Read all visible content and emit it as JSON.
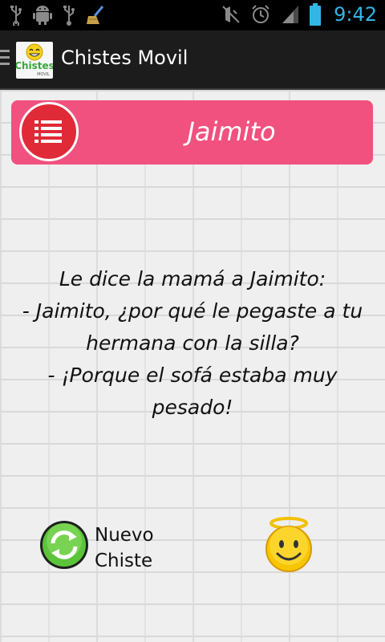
{
  "status_bar": {
    "time": "9:42",
    "icons": [
      "usb-icon",
      "android-debug-icon",
      "usb-icon",
      "cleaner-icon",
      "mute-icon",
      "alarm-icon",
      "signal-icon",
      "battery-icon"
    ],
    "accent_color": "#33b5e5"
  },
  "action_bar": {
    "title": "Chistes Movil",
    "logo_text": "Chistes",
    "logo_subtext": "MOVIL"
  },
  "category": {
    "label": "Jaimito",
    "color": "#f0517f",
    "icon": "list-icon"
  },
  "joke": {
    "text": "Le dice la mamá a Jaimito:\n- Jaimito, ¿por qué le pegaste a tu hermana con la silla?\n- ¡Porque el sofá estaba muy pesado!"
  },
  "controls": {
    "new_joke_label": "Nuevo\nChiste",
    "new_joke_icon": "refresh-icon",
    "rate_icon": "angel-smiley-icon"
  }
}
